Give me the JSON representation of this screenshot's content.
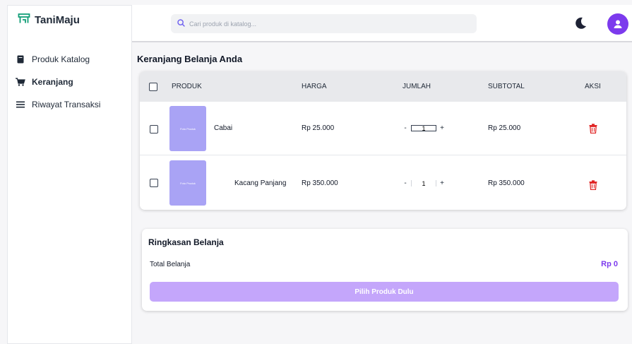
{
  "app": {
    "name": "TaniMaju"
  },
  "sidebar": {
    "items": [
      {
        "label": "Produk Katalog",
        "icon": "book-icon"
      },
      {
        "label": "Keranjang",
        "icon": "cart-icon",
        "active": true
      },
      {
        "label": "Riwayat Transaksi",
        "icon": "list-icon"
      }
    ]
  },
  "header": {
    "search_placeholder": "Cari produk di katalog..."
  },
  "cart": {
    "title": "Keranjang Belanja Anda",
    "columns": {
      "product": "PRODUK",
      "price": "HARGA",
      "qty": "JUMLAH",
      "subtotal": "SUBTOTAL",
      "action": "AKSI"
    },
    "items": [
      {
        "name": "Cabai",
        "thumb_label": "Foto Produk",
        "price": "Rp 25.000",
        "qty": "1",
        "subtotal": "Rp 25.000",
        "minus": "-",
        "plus": "+"
      },
      {
        "name": "Kacang Panjang",
        "thumb_label": "Foto Produk",
        "price": "Rp 350.000",
        "qty": "1",
        "subtotal": "Rp 350.000",
        "minus": "-",
        "plus": "+"
      }
    ]
  },
  "summary": {
    "title": "Ringkasan Belanja",
    "total_label": "Total Belanja",
    "total_value": "Rp 0",
    "button_label": "Pilih Produk Dulu"
  },
  "colors": {
    "accent": "#7c3aed",
    "brand_icon": "#0f9d76",
    "thumb": "#a9a3f5",
    "delete": "#e02424",
    "button_disabled": "#c4a6fb"
  }
}
